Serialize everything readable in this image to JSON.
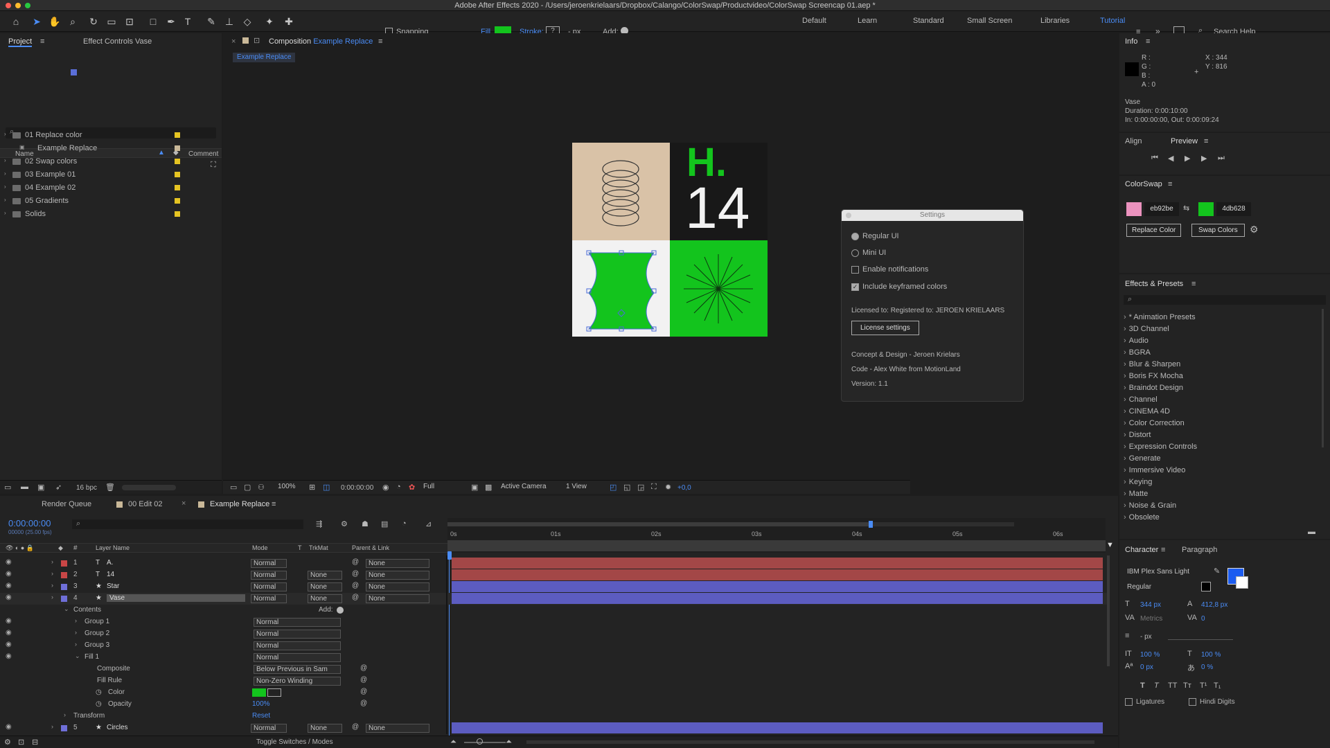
{
  "window": {
    "title": "Adobe After Effects 2020 - /Users/jeroenkrielaars/Dropbox/Calango/ColorSwap/Productvideo/ColorSwap Screencap 01.aep *"
  },
  "toolbar": {
    "snapping": "Snapping",
    "fill": "Fill",
    "stroke": "Stroke:",
    "stroke_px": "- px",
    "add": "Add:",
    "workspaces": [
      "Default",
      "Learn",
      "Standard",
      "Small Screen",
      "Libraries",
      "Tutorial"
    ],
    "search": "Search Help"
  },
  "project": {
    "tab": "Project",
    "effect_controls": "Effect Controls Vase",
    "col_name": "Name",
    "col_comment": "Comment",
    "items": [
      {
        "name": "01 Replace color",
        "color": "#e5c422",
        "indent": 0
      },
      {
        "name": "Example Replace",
        "color": "#c9b898",
        "indent": 1
      },
      {
        "name": "02 Swap colors",
        "color": "#e5c422",
        "indent": 0
      },
      {
        "name": "03 Example 01",
        "color": "#e5c422",
        "indent": 0
      },
      {
        "name": "04 Example 02",
        "color": "#e5c422",
        "indent": 0
      },
      {
        "name": "05 Gradients",
        "color": "#e5c422",
        "indent": 0
      },
      {
        "name": "Solids",
        "color": "#e5c422",
        "indent": 0
      }
    ],
    "bpc": "16 bpc"
  },
  "composition": {
    "tab_prefix": "Composition",
    "name": "Example Replace",
    "crumb": "Example Replace",
    "zoom": "100%",
    "time": "0:00:00:00",
    "res": "Full",
    "camera": "Active Camera",
    "view": "1 View",
    "offset": "+0,0",
    "art_h": "H.",
    "art_14": "14"
  },
  "settings": {
    "title": "Settings",
    "regular_ui": "Regular UI",
    "mini_ui": "Mini UI",
    "notifications": "Enable notifications",
    "keyframed": "Include keyframed colors",
    "license": "Licensed to:  Registered to: JEROEN KRIELAARS",
    "license_btn": "License settings",
    "credit1": "Concept & Design - Jeroen Krielars",
    "credit2": "Code - Alex White from MotionLand",
    "version": "Version: 1.1"
  },
  "info": {
    "tab": "Info",
    "r": "R :",
    "g": "G :",
    "b": "B :",
    "a": "A : 0",
    "x": "X : 344",
    "y": "Y : 816",
    "layer": "Vase",
    "duration": "Duration: 0:00:10:00",
    "inout": "In: 0:00:00:00, Out: 0:00:09:24"
  },
  "preview": {
    "align": "Align",
    "tab": "Preview"
  },
  "colorswap": {
    "tab": "ColorSwap",
    "color1": "eb92be",
    "color2": "4db628",
    "hex1": "#eb92be",
    "hex2": "#4db628",
    "replace": "Replace Color",
    "swap": "Swap Colors"
  },
  "effects": {
    "tab": "Effects & Presets",
    "items": [
      "* Animation Presets",
      "3D Channel",
      "Audio",
      "BGRA",
      "Blur & Sharpen",
      "Boris FX Mocha",
      "Braindot Design",
      "Channel",
      "CINEMA 4D",
      "Color Correction",
      "Distort",
      "Expression Controls",
      "Generate",
      "Immersive Video",
      "Keying",
      "Matte",
      "Noise & Grain",
      "Obsolete"
    ]
  },
  "character": {
    "tab": "Character",
    "paragraph": "Paragraph",
    "font": "IBM Plex Sans Light",
    "style": "Regular",
    "size": "344 px",
    "leading": "412,8 px",
    "kerning": "Metrics",
    "tracking": "0",
    "stroke_w": "- px",
    "vscale": "100 %",
    "hscale": "100 %",
    "baseline": "0 px",
    "tsume": "0 %",
    "ligatures": "Ligatures",
    "hindi": "Hindi Digits"
  },
  "timeline": {
    "tabs": [
      "Render Queue",
      "00 Edit 02",
      "Example Replace"
    ],
    "timecode": "0:00:00:00",
    "fps": "00000 (25.00 fps)",
    "col_layer": "Layer Name",
    "col_mode": "Mode",
    "col_t": "T",
    "col_trkmat": "TrkMat",
    "col_parent": "Parent & Link",
    "ruler": [
      "0s",
      "01s",
      "02s",
      "03s",
      "04s",
      "05s",
      "06s"
    ],
    "layers": [
      {
        "num": "1",
        "name": "A.",
        "type": "T",
        "color": "#c94646",
        "mode": "Normal",
        "trk": "",
        "parent": "None"
      },
      {
        "num": "2",
        "name": "14",
        "type": "T",
        "color": "#c94646",
        "mode": "Normal",
        "trk": "None",
        "parent": "None"
      },
      {
        "num": "3",
        "name": "Star",
        "type": "★",
        "color": "#6f6fd8",
        "mode": "Normal",
        "trk": "None",
        "parent": "None"
      },
      {
        "num": "4",
        "name": "Vase",
        "type": "★",
        "color": "#6f6fd8",
        "mode": "Normal",
        "trk": "None",
        "parent": "None"
      }
    ],
    "contents": "Contents",
    "add": "Add:",
    "groups": [
      "Group 1",
      "Group 2",
      "Group 3"
    ],
    "group_mode": "Normal",
    "fill": "Fill 1",
    "fill_mode": "Normal",
    "composite": "Composite",
    "composite_val": "Below Previous in Sam",
    "fill_rule": "Fill Rule",
    "fill_rule_val": "Non-Zero Winding",
    "color": "Color",
    "opacity": "Opacity",
    "opacity_val": "100%",
    "transform": "Transform",
    "reset": "Reset",
    "layer5": {
      "num": "5",
      "name": "Circles",
      "mode": "Normal",
      "trk": "None",
      "parent": "None"
    },
    "toggle": "Toggle Switches / Modes"
  }
}
